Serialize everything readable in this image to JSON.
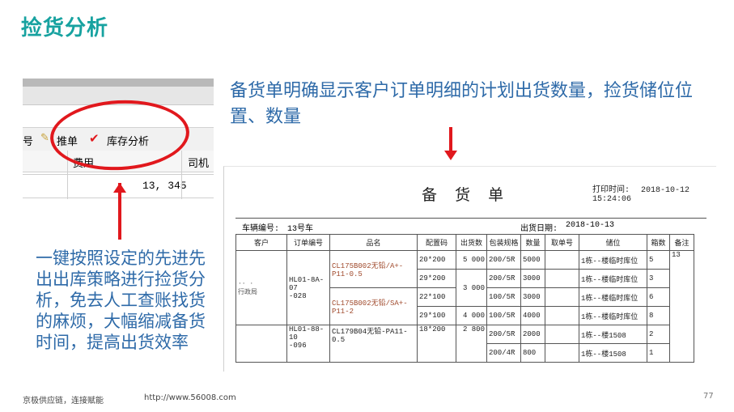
{
  "slide": {
    "title": "捡货分析",
    "left_caption": "一键按照设定的先进先出出库策略进行捡货分析，免去人工查账找货的麻烦，大幅缩减备货时间，提高出货效率",
    "right_caption": "备货单明确显示客户订单明细的计划出货数量，捡货储位位置、数量",
    "footer_left": "京极供应链，连接赋能",
    "footer_url": "http://www.56008.com",
    "page_number": "77"
  },
  "screenshot": {
    "toolbar_partial": "号",
    "push_label": "推单",
    "stock_analysis_label": "库存分析",
    "col_fee": "费用",
    "col_driver": "司机",
    "row_value": "13, 345"
  },
  "doc": {
    "title": "备 货 单",
    "print_time_label": "打印时间:",
    "print_time": "2018-10-12 15:24:06",
    "vehicle_label": "车辆编号:",
    "vehicle": "13号车",
    "ship_date_label": "出货日期:",
    "ship_date": "2018-10-13",
    "headers": [
      "客户",
      "订单编号",
      "品名",
      "配置码",
      "出货数",
      "包装规格",
      "数量",
      "取单号",
      "储位",
      "箱数",
      "备注"
    ],
    "cust1": "·· ·\n行政局",
    "order1": "HL01-8A-07\n-028",
    "prod1a": "CL175B002无铅/A+-P11-0.5",
    "prod1b": "CL175B002无铅/SA+-P11-2",
    "order2": "HL01-88-10\n-096",
    "prod2": "CL179B04无铅-PA11-0.5",
    "rows": [
      {
        "code": "20*200",
        "ship": "5 000",
        "pack": "200/5R",
        "qty": "5000",
        "loc": "1栋--楼临时库位",
        "box": "5",
        "note": "13"
      },
      {
        "code": "29*200",
        "ship": "",
        "pack": "200/5R",
        "qty": "3000",
        "loc": "1栋--楼临时库位",
        "box": "3",
        "note": ""
      },
      {
        "code": "22*100",
        "ship": "3 000",
        "pack": "100/5R",
        "qty": "3000",
        "loc": "1栋--楼临时库位",
        "box": "6",
        "note": ""
      },
      {
        "code": "29*100",
        "ship": "4 000",
        "pack": "100/5R",
        "qty": "4000",
        "loc": "1栋--楼临时库位",
        "box": "8",
        "note": ""
      },
      {
        "code": "18*200",
        "ship": "2 800",
        "pack": "200/5R",
        "qty": "2000",
        "loc": "1栋--楼1508",
        "box": "2",
        "note": ""
      },
      {
        "code": "",
        "ship": "",
        "pack": "200/4R",
        "qty": "800",
        "loc": "1栋--楼1508",
        "box": "1",
        "note": ""
      }
    ]
  },
  "colors": {
    "title": "#17a2a0",
    "caption": "#2e6aa8",
    "highlight": "#e1181d"
  }
}
